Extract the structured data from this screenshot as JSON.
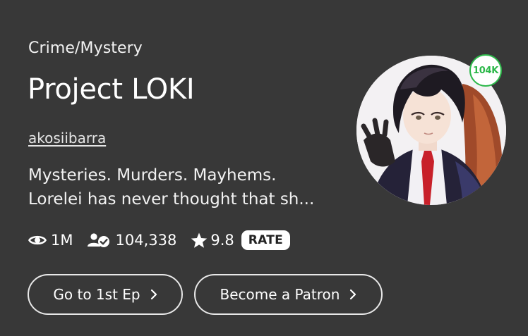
{
  "series": {
    "genre": "Crime/Mystery",
    "title": "Project LOKI",
    "author": "akosiibarra",
    "description_lines": [
      "Mysteries. Murders. Mayhems.",
      "Lorelei has never thought that sh..."
    ],
    "cover_badge": "104K"
  },
  "stats": {
    "views": "1M",
    "subscribers": "104,338",
    "rating": "9.8",
    "rate_label": "RATE"
  },
  "actions": {
    "first_episode_label": "Go to 1st Ep",
    "patron_label": "Become a Patron"
  },
  "icons": {
    "views": "eye-icon",
    "subscribers": "subscriber-check-icon",
    "rating": "star-icon",
    "chevron": "chevron-right-icon"
  },
  "colors": {
    "background": "#383838",
    "badge_green": "#2db84a"
  }
}
